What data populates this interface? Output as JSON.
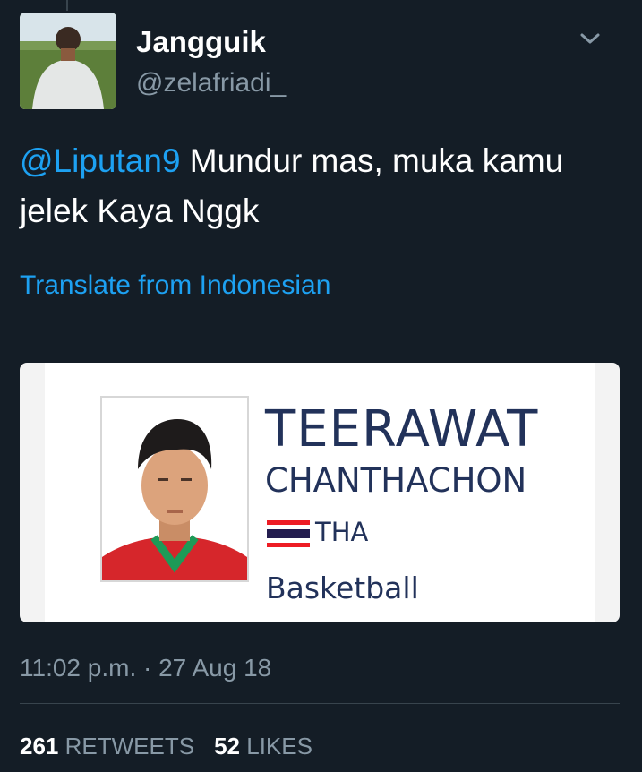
{
  "tweet": {
    "author_name": "Jangguik",
    "author_handle": "@zelafriadi_",
    "mention": "@Liputan9",
    "text": " Mundur mas, muka kamu jelek Kaya Nggk",
    "translate_link": "Translate from Indonesian",
    "timestamp": "11:02 p.m. · 27 Aug 18",
    "retweets_count": "261",
    "retweets_label": "RETWEETS",
    "likes_count": "52",
    "likes_label": "LIKES"
  },
  "card": {
    "first_name": "TEERAWAT",
    "last_name": "CHANTHACHON",
    "country": "THA",
    "sport": "Basketball"
  },
  "icons": {
    "menu": "chevron-down-icon",
    "flag": "thailand-flag-icon"
  },
  "colors": {
    "background": "#141d26",
    "link": "#1da1f2",
    "secondary_text": "#8899a6",
    "card_text": "#22325a"
  }
}
